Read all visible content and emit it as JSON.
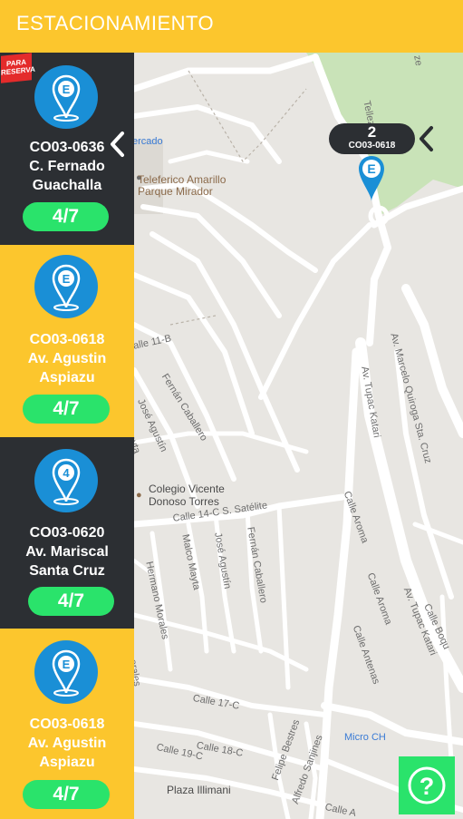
{
  "header": {
    "title": "ESTACIONAMIENTO"
  },
  "sidebar": {
    "cards": [
      {
        "code": "CO03-0636",
        "name_line1": "C. Fernado",
        "name_line2": "Guachalla",
        "availability": "4/7",
        "badge_line1": "PARA",
        "badge_line2": "RESERVA"
      },
      {
        "code": "CO03-0618",
        "name_line1": "Av. Agustin",
        "name_line2": "Aspiazu",
        "availability": "4/7"
      },
      {
        "code": "CO03-0620",
        "name_line1": "Av. Mariscal",
        "name_line2": "Santa Cruz",
        "availability": "4/7",
        "pin_number": "4"
      },
      {
        "code": "CO03-0618",
        "name_line1": "Av. Agustin",
        "name_line2": "Aspiazu",
        "availability": "4/7"
      }
    ]
  },
  "map": {
    "marker": {
      "count": "2",
      "code": "CO03-0618"
    },
    "labels": {
      "mercado": "ercado",
      "teleferico_1": "Teleferico Amarillo",
      "teleferico_2": "Parque Mirador",
      "tellez": "Tellez",
      "calle_11b": "alle 11-B",
      "fernan_caballero": "Fernán Caballero",
      "jose_agustin": "José Agustín",
      "marcelo": "Av. Marcelo Quiroga Sta. Cruz",
      "tupac_katari": "Av. Tupac Katari",
      "colegio_1": "Colegio Vicente",
      "colegio_2": "Donoso Torres",
      "calle_14c": "Calle 14-C S. Satélite",
      "calle_aroma_1": "Calle Aroma",
      "calle_aroma_2": "Calle Aroma",
      "hermano_morales": "Hermano Morales",
      "malco_mayta": "Malco Mayta",
      "jose_agustin_2": "José Agustín",
      "fernan_caballero_2": "Fernán Caballero",
      "calle_antenas": "Calle Antenas",
      "tupac_katari_2": "Av. Tupac Katari",
      "calle_boq": "Calle Boqu",
      "calle_17c": "Calle 17-C",
      "calle_18c": "Calle 18-C",
      "calle_19c": "Calle 19-C",
      "felipe_bestres": "Felipe Bestres",
      "alfredo_sanjines": "Alfredo Sanjines",
      "micro_ch": "Micro CH",
      "plaza_illimani": "Plaza Illimani",
      "morales": "orales",
      "mayta": "ayta",
      "zel": "ze",
      "calle_bottom": "Calle A"
    }
  },
  "help": {
    "symbol": "?"
  },
  "colors": {
    "accent": "#fcc62d",
    "dark": "#2c2f33",
    "green": "#2ae36b",
    "pin_blue": "#1a8fd6"
  }
}
